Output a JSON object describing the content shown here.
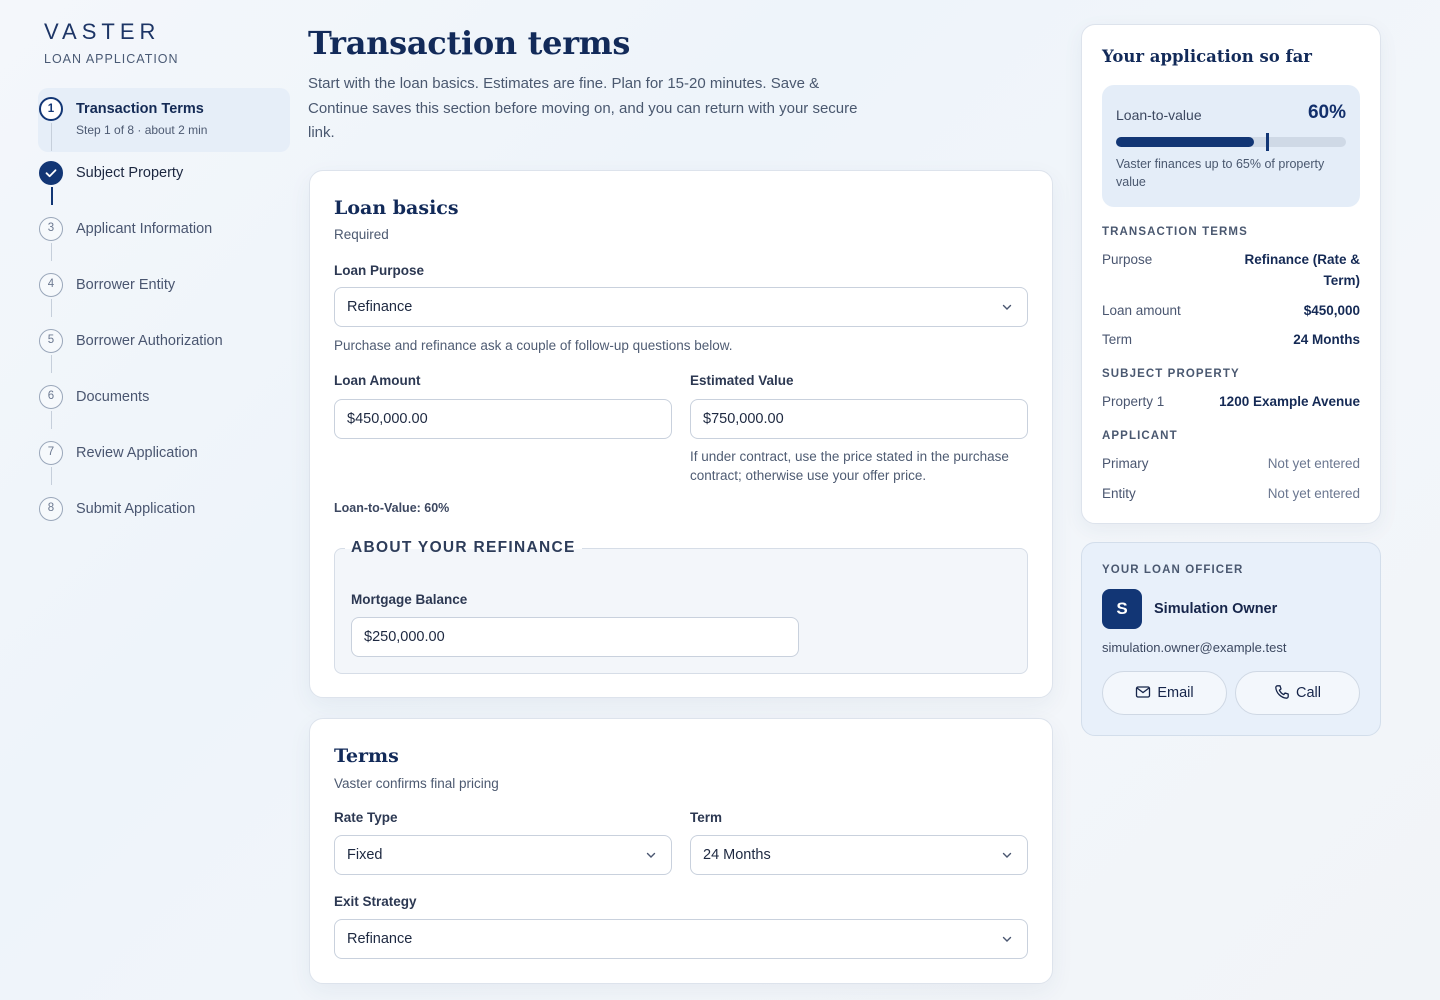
{
  "brand": {
    "logo": "VASTER",
    "app_label": "LOAN APPLICATION"
  },
  "steps": [
    {
      "num": "1",
      "title": "Transaction Terms",
      "sub": "Step 1 of 8 · about 2 min",
      "state": "active"
    },
    {
      "num": "",
      "title": "Subject Property",
      "state": "done"
    },
    {
      "num": "3",
      "title": "Applicant Information"
    },
    {
      "num": "4",
      "title": "Borrower Entity"
    },
    {
      "num": "5",
      "title": "Borrower Authorization"
    },
    {
      "num": "6",
      "title": "Documents"
    },
    {
      "num": "7",
      "title": "Review Application"
    },
    {
      "num": "8",
      "title": "Submit Application"
    }
  ],
  "page": {
    "title": "Transaction terms",
    "intro": "Start with the loan basics. Estimates are fine. Plan for 15-20 minutes. Save & Continue saves this section before moving on, and you can return with your secure link."
  },
  "loan_basics": {
    "title": "Loan basics",
    "sub": "Required",
    "purpose_label": "Loan Purpose",
    "purpose_value": "Refinance",
    "purpose_hint": "Purchase and refinance ask a couple of follow-up questions below.",
    "amount_label": "Loan Amount",
    "amount_value": "$450,000.00",
    "value_label": "Estimated Value",
    "value_value": "$750,000.00",
    "value_hint": "If under contract, use the price stated in the purchase contract; otherwise use your offer price.",
    "ltv_note": "Loan-to-Value: 60%",
    "refi_legend": "ABOUT YOUR REFINANCE",
    "mortgage_label": "Mortgage Balance",
    "mortgage_value": "$250,000.00"
  },
  "terms": {
    "title": "Terms",
    "sub": "Vaster confirms final pricing",
    "rate_label": "Rate Type",
    "rate_value": "Fixed",
    "term_label": "Term",
    "term_value": "24 Months",
    "exit_label": "Exit Strategy",
    "exit_value": "Refinance"
  },
  "summary": {
    "title": "Your application so far",
    "ltv_label": "Loan-to-value",
    "ltv_value": "60%",
    "ltv_fraction": 0.6,
    "ltv_max_fraction": 0.65,
    "ltv_desc": "Vaster finances up to 65% of property value",
    "sections": {
      "transaction": "TRANSACTION TERMS",
      "property": "SUBJECT PROPERTY",
      "applicant": "APPLICANT"
    },
    "purpose_k": "Purpose",
    "purpose_v": "Refinance (Rate & Term)",
    "amount_k": "Loan amount",
    "amount_v": "$450,000",
    "term_k": "Term",
    "term_v": "24 Months",
    "property_k": "Property 1",
    "property_v": "1200 Example Avenue",
    "primary_k": "Primary",
    "primary_v": "Not yet entered",
    "entity_k": "Entity",
    "entity_v": "Not yet entered"
  },
  "officer": {
    "heading": "YOUR LOAN OFFICER",
    "initial": "S",
    "name": "Simulation Owner",
    "email": "simulation.owner@example.test",
    "email_btn": "Email",
    "call_btn": "Call"
  },
  "colors": {
    "accent": "#123675",
    "title": "#122a59",
    "soft_panel": "#e4edf8"
  }
}
